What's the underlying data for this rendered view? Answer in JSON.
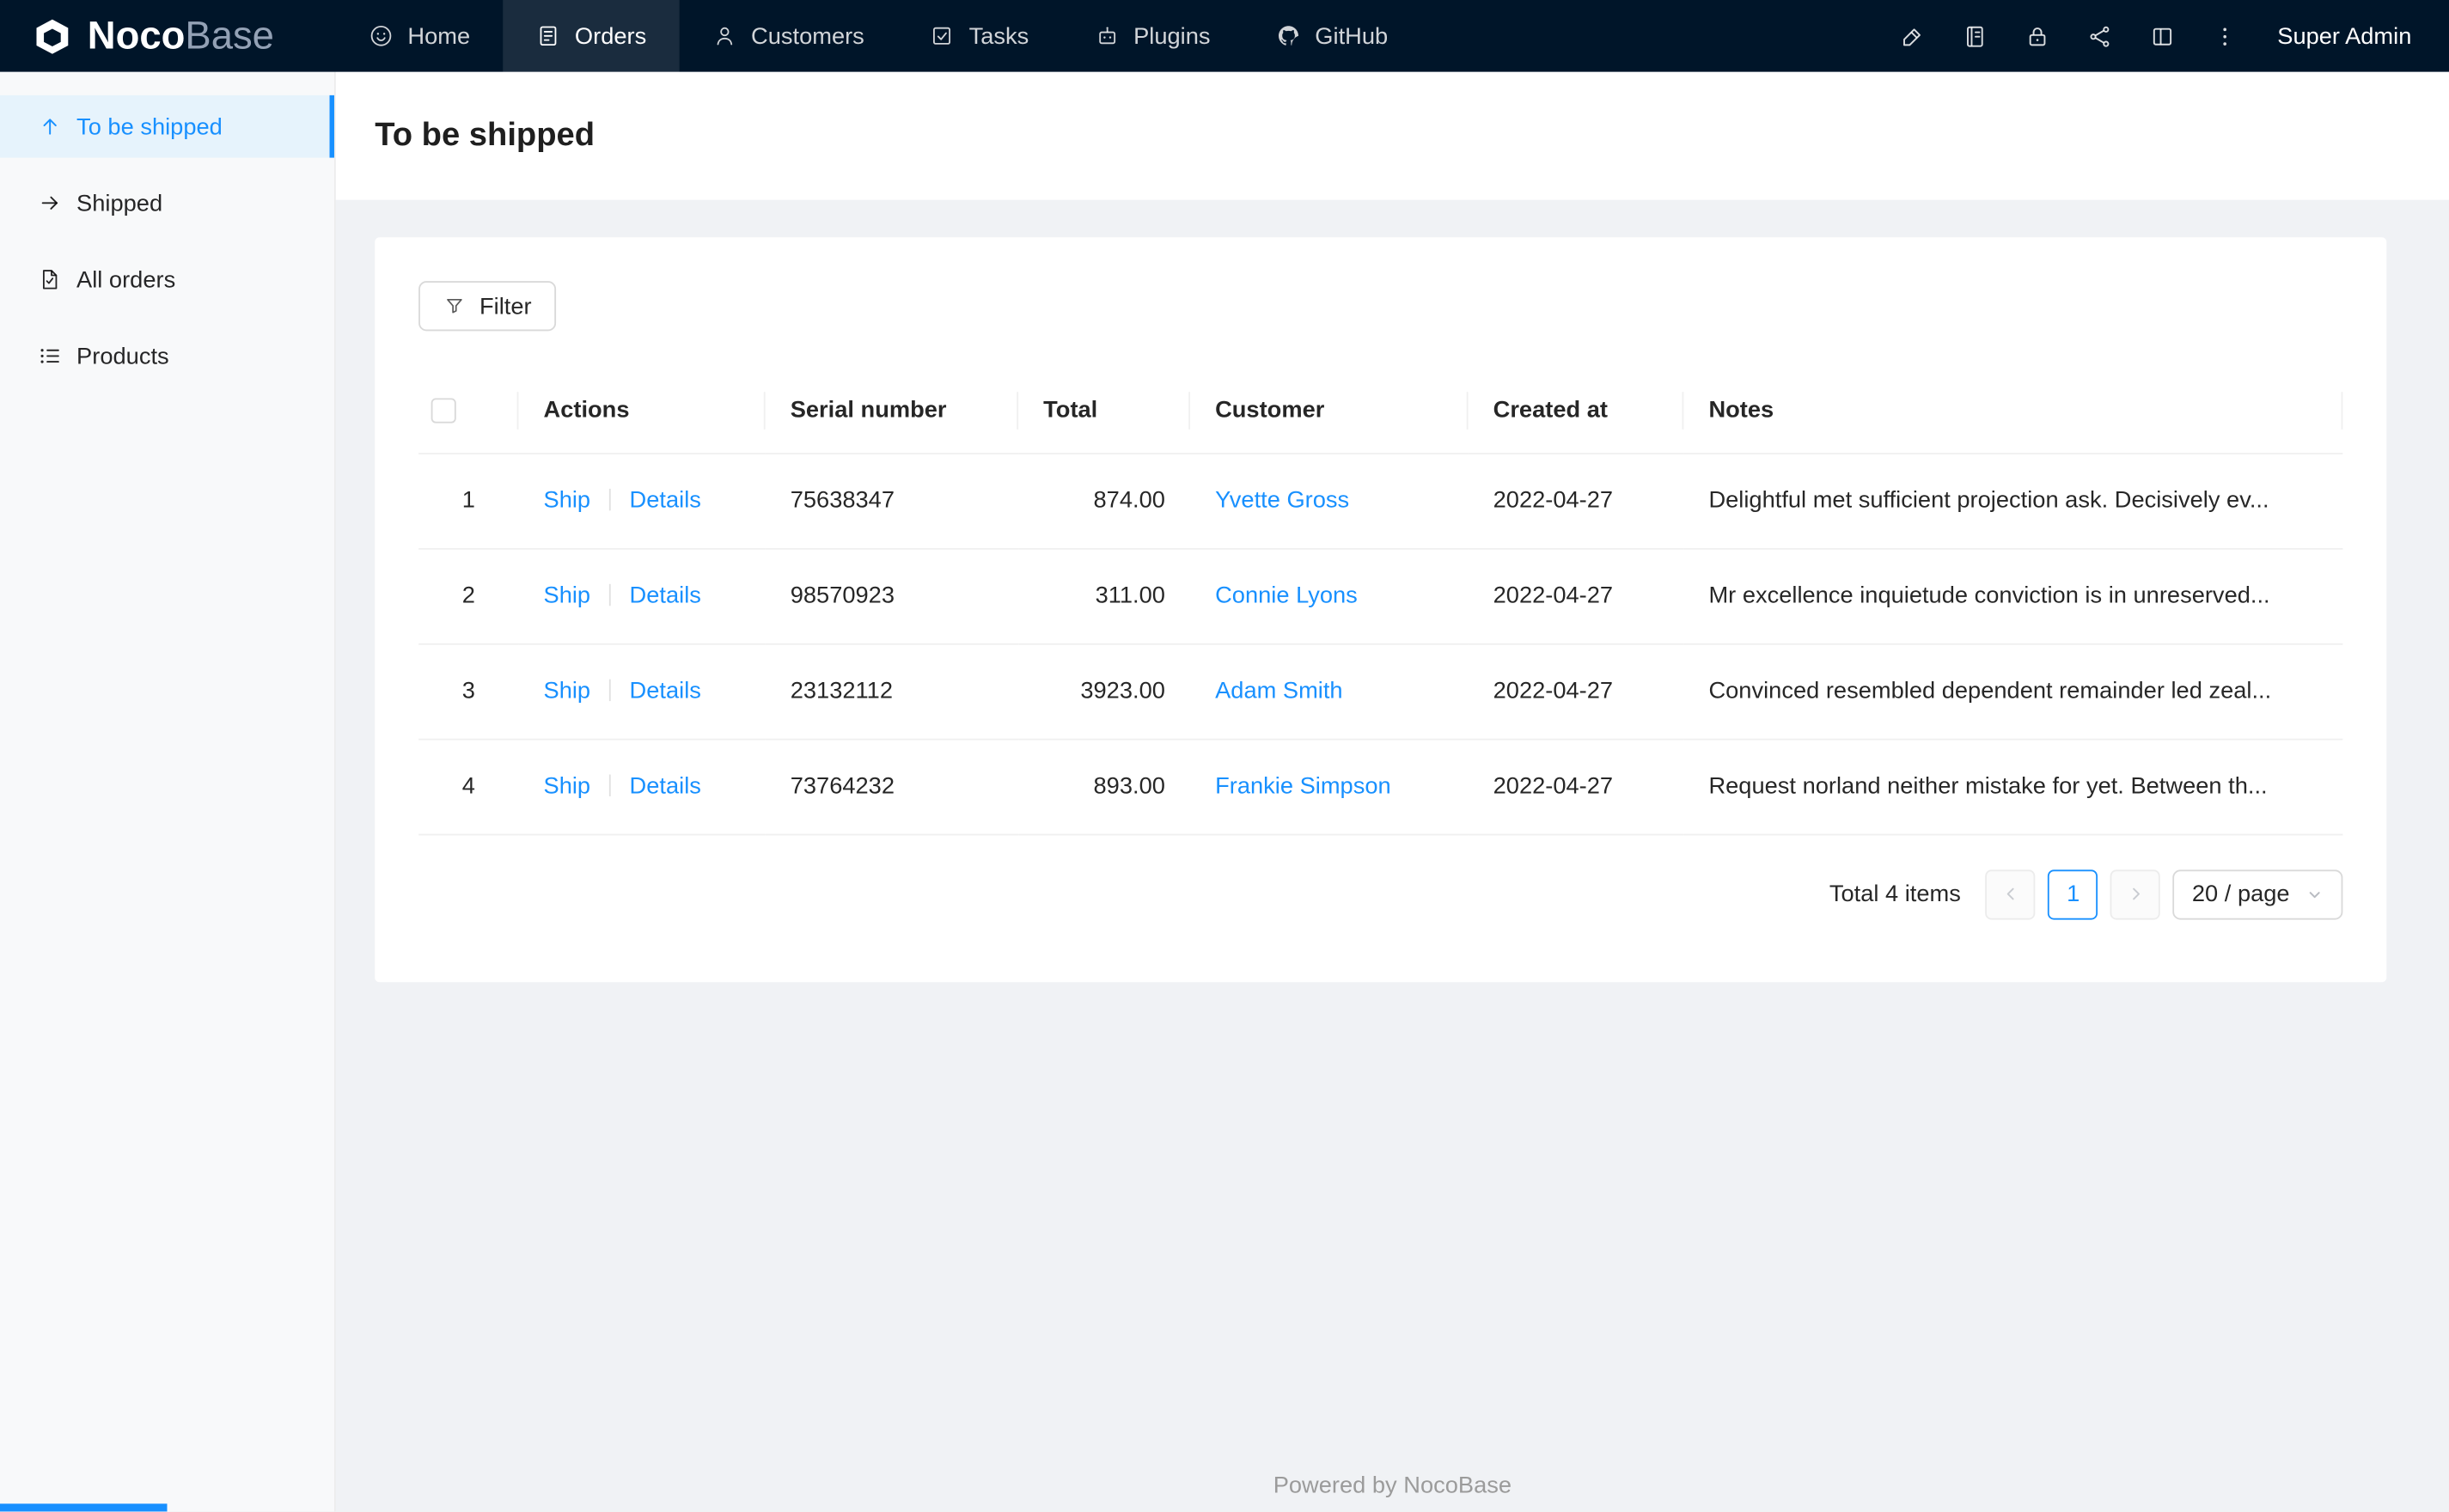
{
  "topbar": {
    "logo": {
      "part1": "Noco",
      "part2": "Base"
    },
    "nav": [
      {
        "label": "Home",
        "icon": "smile-icon",
        "active": false
      },
      {
        "label": "Orders",
        "icon": "orders-file-icon",
        "active": true
      },
      {
        "label": "Customers",
        "icon": "user-icon",
        "active": false
      },
      {
        "label": "Tasks",
        "icon": "check-square-icon",
        "active": false
      },
      {
        "label": "Plugins",
        "icon": "robot-icon",
        "active": false
      },
      {
        "label": "GitHub",
        "icon": "github-icon",
        "active": false
      }
    ],
    "action_icons": [
      "highlighter-icon",
      "notebook-icon",
      "lock-icon",
      "share-nodes-icon",
      "split-panel-icon",
      "more-vertical-icon"
    ],
    "user": "Super Admin"
  },
  "sidebar": {
    "items": [
      {
        "label": "To be shipped",
        "icon": "arrow-up-icon",
        "active": true
      },
      {
        "label": "Shipped",
        "icon": "arrow-right-icon",
        "active": false
      },
      {
        "label": "All orders",
        "icon": "file-check-icon",
        "active": false
      },
      {
        "label": "Products",
        "icon": "list-icon",
        "active": false
      }
    ]
  },
  "page": {
    "title": "To be shipped"
  },
  "toolbar": {
    "filter_label": "Filter"
  },
  "table": {
    "columns": {
      "actions": "Actions",
      "serial": "Serial number",
      "total": "Total",
      "customer": "Customer",
      "created": "Created at",
      "notes": "Notes"
    },
    "action_labels": {
      "ship": "Ship",
      "details": "Details"
    },
    "rows": [
      {
        "index": "1",
        "serial": "75638347",
        "total": "874.00",
        "customer": "Yvette Gross",
        "created_at": "2022-04-27",
        "notes": "Delightful met sufficient projection ask. Decisively ev..."
      },
      {
        "index": "2",
        "serial": "98570923",
        "total": "311.00",
        "customer": "Connie Lyons",
        "created_at": "2022-04-27",
        "notes": "Mr excellence inquietude conviction is in unreserved..."
      },
      {
        "index": "3",
        "serial": "23132112",
        "total": "3923.00",
        "customer": "Adam Smith",
        "created_at": "2022-04-27",
        "notes": "Convinced resembled dependent remainder led zeal..."
      },
      {
        "index": "4",
        "serial": "73764232",
        "total": "893.00",
        "customer": "Frankie Simpson",
        "created_at": "2022-04-27",
        "notes": "Request norland neither mistake for yet. Between th..."
      }
    ]
  },
  "pagination": {
    "total_text": "Total 4 items",
    "current_page": "1",
    "page_size": "20 / page"
  },
  "footer": {
    "text": "Powered by NocoBase"
  },
  "colors": {
    "accent": "#1890ff",
    "topbar_bg": "#001529",
    "content_bg": "#f0f2f5",
    "active_sidebar_bg": "#e6f3fc",
    "link": "#1890ff"
  }
}
